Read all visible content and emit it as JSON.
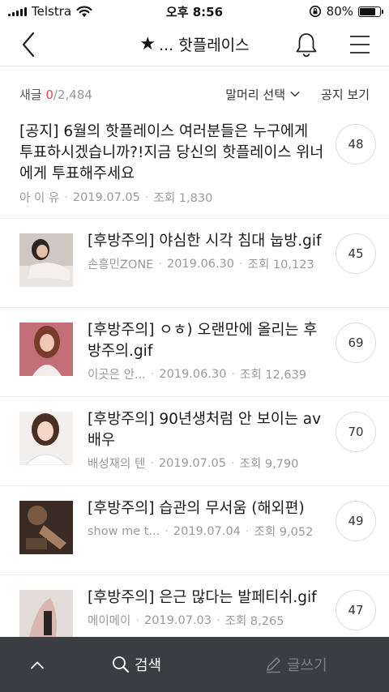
{
  "status": {
    "carrier": "Telstra",
    "time": "오후 8:56",
    "battery": "80%",
    "battery_level": 0.8
  },
  "nav": {
    "star": "★",
    "title": "... 핫플레이스"
  },
  "subbar": {
    "new_label": "새글 ",
    "new_count": "0",
    "total": "/2,484",
    "prefix_select": "말머리 선택",
    "notice_view": "공지 보기"
  },
  "notice": {
    "title": "[공지] 6월의 핫플레이스  여러분들은 누구에게 투표하시겠습니까?!지금 당신의 핫플레이스 위너에게 투표해주세요",
    "author": "아 이 유",
    "date": "2019.07.05",
    "views": "조회 1,830",
    "comments": "48"
  },
  "posts": [
    {
      "title": "[후방주의] 야심한 시각 침대 눕방.gif",
      "author": "손흥민ZONE",
      "date": "2019.06.30",
      "views": "조회 10,123",
      "comments": "45"
    },
    {
      "title": "[후방주의] ㅇㅎ) 오랜만에 올리는 후방주의.gif",
      "author": "이곳은 안...",
      "date": "2019.06.30",
      "views": "조회 12,639",
      "comments": "69"
    },
    {
      "title": "[후방주의] 90년생처럼 안 보이는 av배우",
      "author": "배성재의 텐",
      "date": "2019.07.05",
      "views": "조회 9,790",
      "comments": "70"
    },
    {
      "title": "[후방주의] 습관의 무서움 (해외편)",
      "author": "show me t...",
      "date": "2019.07.04",
      "views": "조회 9,052",
      "comments": "49"
    },
    {
      "title": "[후방주의] 은근 많다는 발페티쉬.gif",
      "author": "메이메이",
      "date": "2019.07.03",
      "views": "조회 8,265",
      "comments": "47"
    }
  ],
  "bottom": {
    "search_label": "검색",
    "write_label": "글쓰기"
  }
}
